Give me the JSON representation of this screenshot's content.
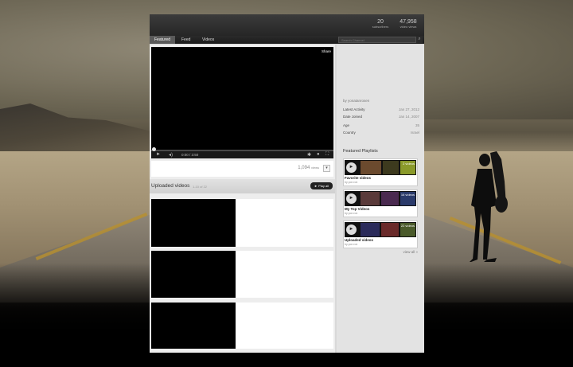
{
  "channel": {
    "stats": [
      {
        "value": "20",
        "label": "subscribers"
      },
      {
        "value": "47,958",
        "label": "video views"
      }
    ]
  },
  "nav": {
    "tabs": [
      "Featured",
      "Feed",
      "Videos"
    ],
    "search_placeholder": "Search Channel"
  },
  "player": {
    "share_label": "Share",
    "time": "0:00 / 3:50",
    "views_count": "1,094",
    "views_label": "views"
  },
  "uploads": {
    "title": "Uploaded videos",
    "count": "1-10 of 22",
    "play_all": "► Play all"
  },
  "sidebar": {
    "by": "by yonatanrosen",
    "info": [
      {
        "label": "Latest Activity",
        "value": "Jan 27, 2012"
      },
      {
        "label": "Date Joined",
        "value": "Jan 14, 2007"
      },
      {
        "label": "Age",
        "value": "35"
      },
      {
        "label": "Country",
        "value": "Israel"
      }
    ],
    "playlists_title": "Featured Playlists",
    "playlists": [
      {
        "name": "Favorite videos",
        "by": "by yon.ron",
        "count": "2 videos"
      },
      {
        "name": "My Top Videos",
        "by": "by yon.ron",
        "count": "16 videos"
      },
      {
        "name": "Uploaded videos",
        "by": "by yon.ron",
        "count": "22 videos"
      }
    ],
    "view_all": "view all »"
  }
}
